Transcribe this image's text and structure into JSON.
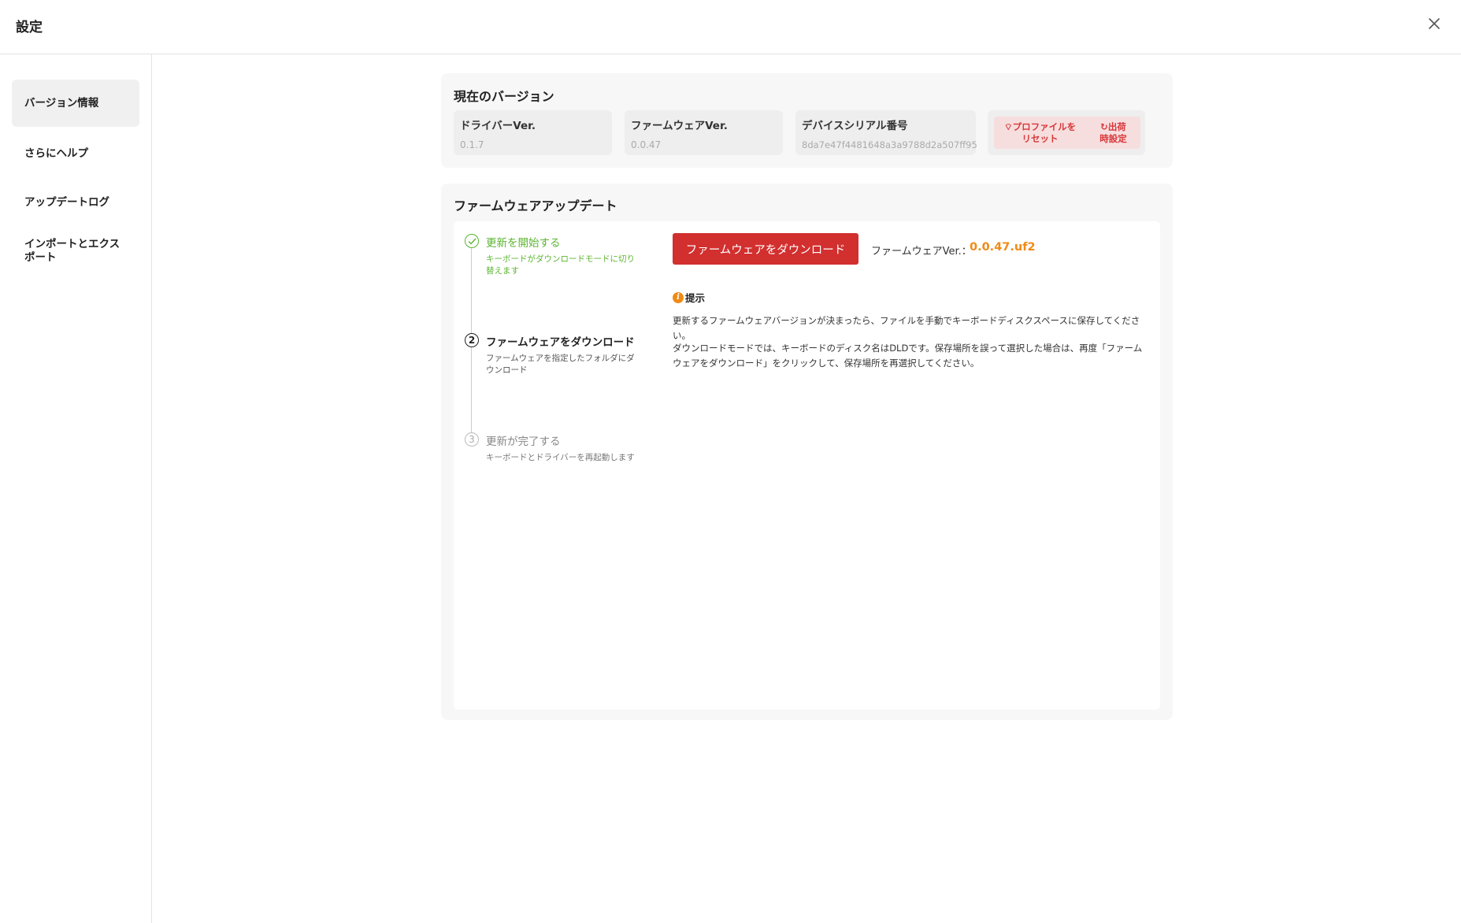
{
  "window": {
    "title": "設定"
  },
  "sidebar": {
    "items": [
      {
        "label": "バージョン情報"
      },
      {
        "label": "さらにヘルプ"
      },
      {
        "label": "アップデートログ"
      },
      {
        "label": "インポートとエクスポート"
      }
    ]
  },
  "version_panel": {
    "title": "現在のバージョン",
    "driver": {
      "label": "ドライバーVer.",
      "value": "0.1.7"
    },
    "firmware": {
      "label": "ファームウェアVer.",
      "value": "0.0.47"
    },
    "serial": {
      "label": "デバイスシリアル番号",
      "value": "8da7e47f4481648a3a9788d2a507ff95"
    },
    "reset_profile_label": "プロファイルをリセット",
    "factory_reset_label": "出荷時設定"
  },
  "update_panel": {
    "title": "ファームウェアアップデート",
    "steps": [
      {
        "number": "1",
        "title": "更新を開始する",
        "desc": "キーボードがダウンロードモードに切り替えます"
      },
      {
        "number": "2",
        "title": "ファームウェアをダウンロード",
        "desc": "ファームウェアを指定したフォルダにダウンロード"
      },
      {
        "number": "3",
        "title": "更新が完了する",
        "desc": "キーボードとドライバーを再起動します"
      }
    ],
    "download_button_label": "ファームウェアをダウンロード",
    "firmware_ver_label": "ファームウェアVer.：",
    "firmware_ver_value": "0.0.47.uf2",
    "hint_title": "提示",
    "hint_paragraph_1": "更新するファームウェアバージョンが決まったら、ファイルを手動でキーボードディスクスペースに保存してください。",
    "hint_paragraph_2": "ダウンロードモードでは、キーボードのディスク名はDLDです。保存場所を誤って選択した場合は、再度「ファームウェアをダウンロード」をクリックして、保存場所を再選択してください。"
  },
  "colors": {
    "accent_red": "#d22f2f",
    "orange": "#f08a16",
    "done_green": "#5cb531"
  }
}
